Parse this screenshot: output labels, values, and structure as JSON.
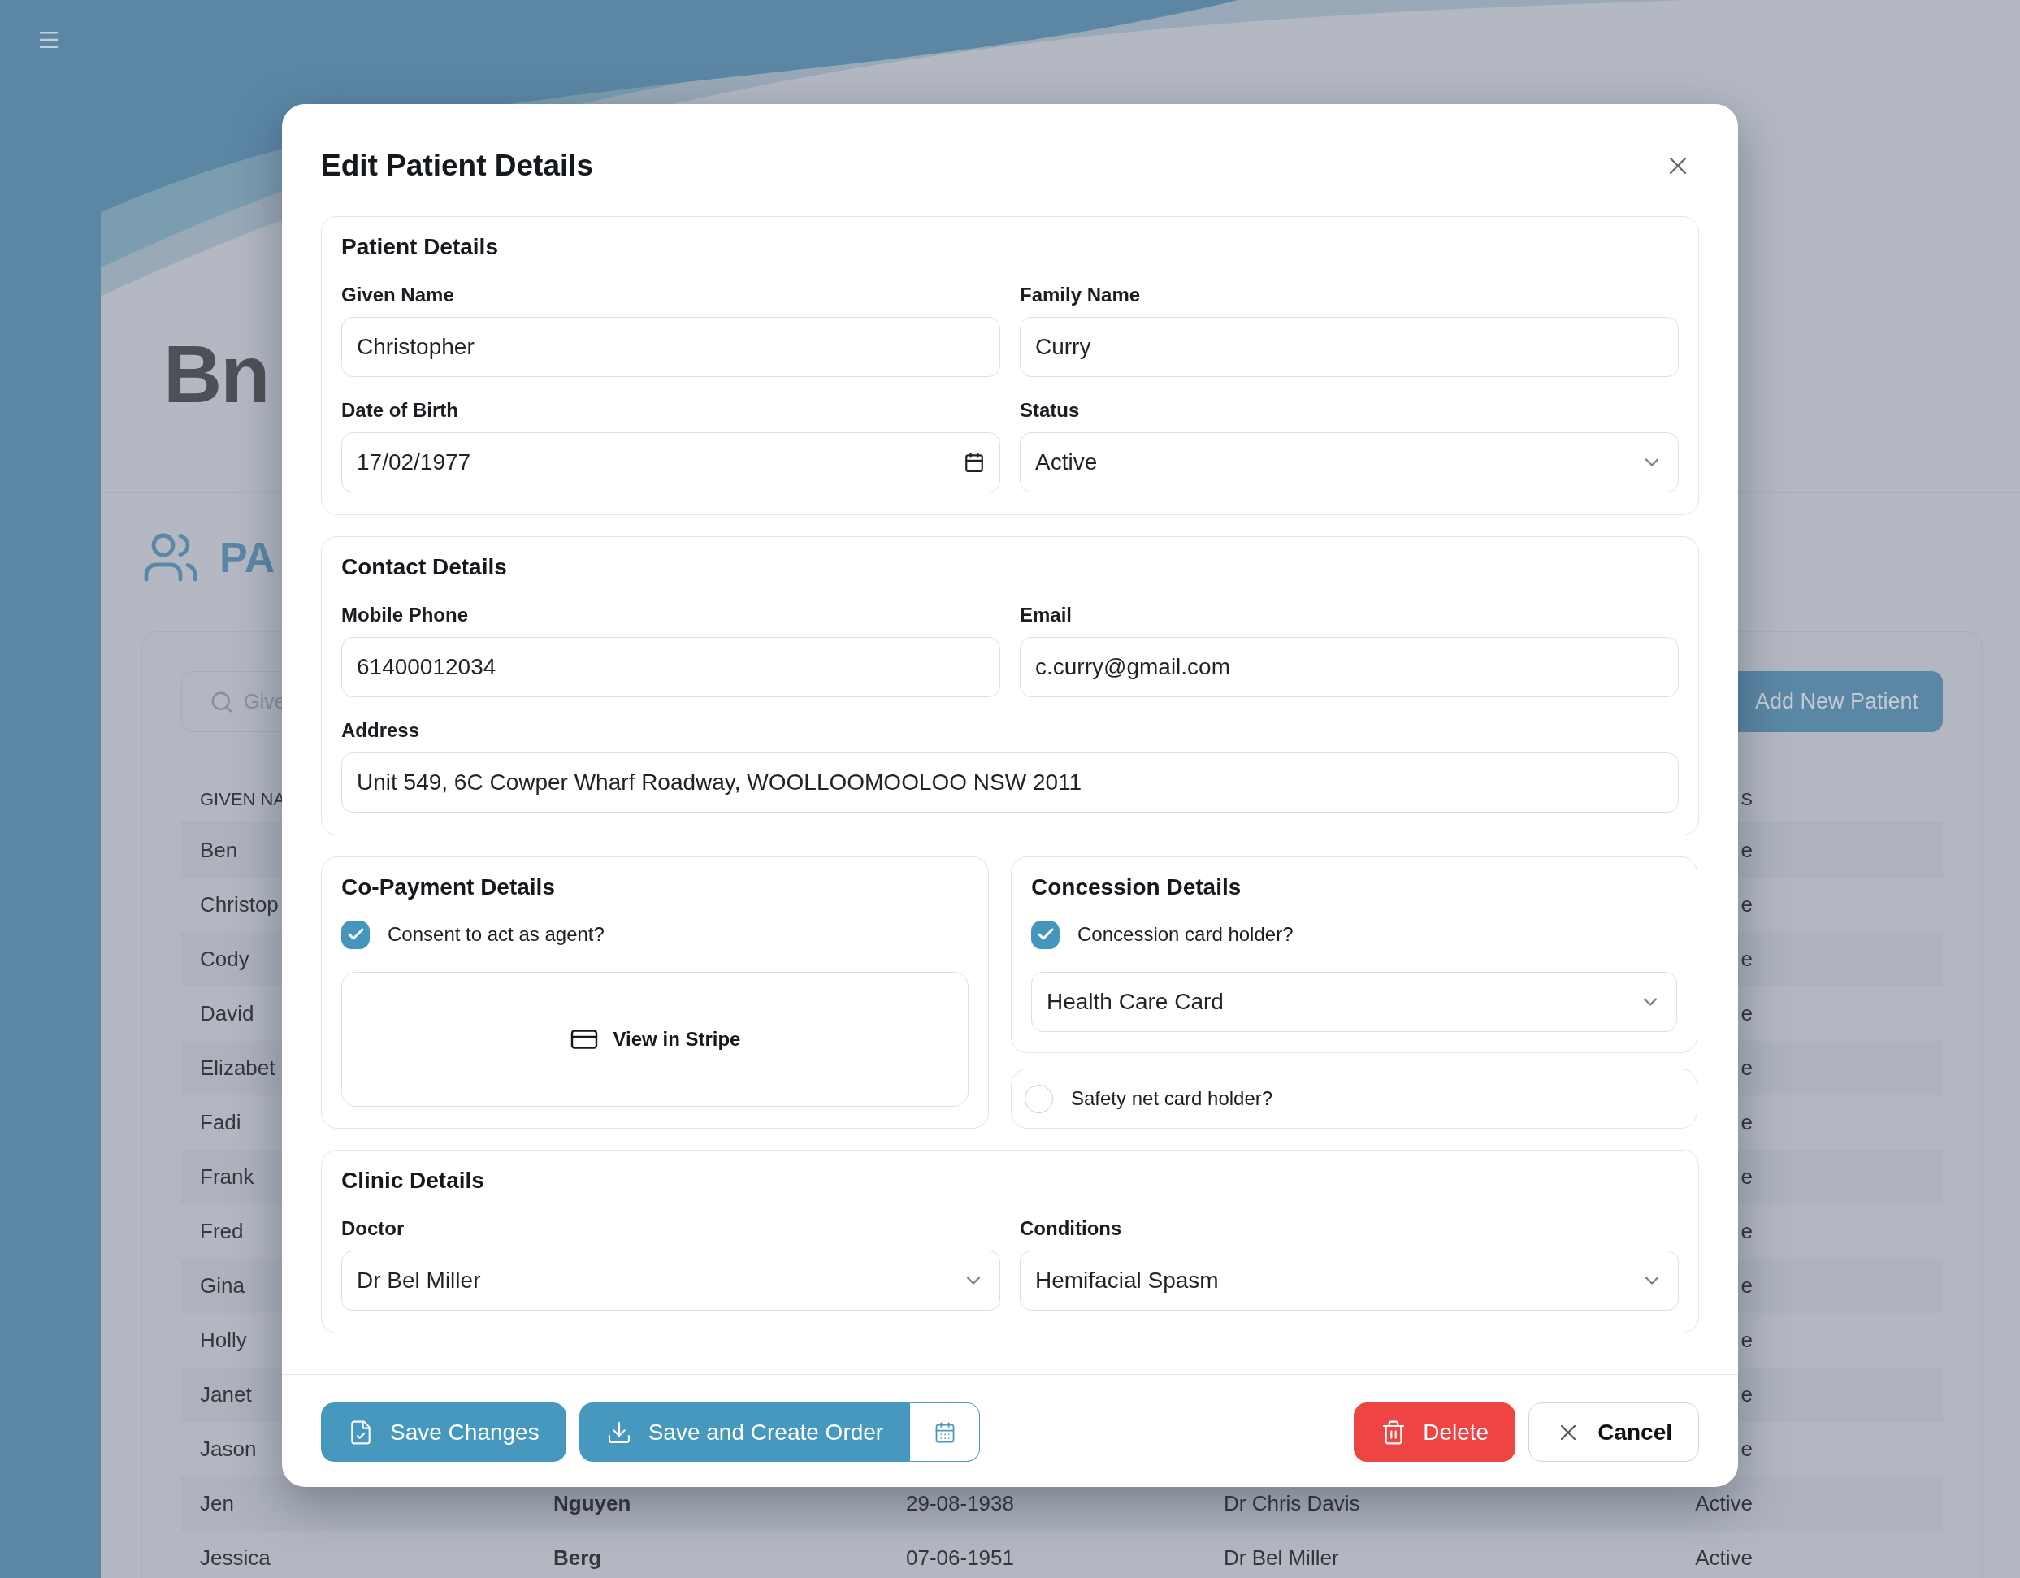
{
  "background": {
    "logo": "Bn",
    "heading": "PA",
    "search": {
      "placeholder": "Give"
    },
    "add_button": "Add New Patient",
    "table": {
      "header_first": "GIVEN NA",
      "header_last": "S",
      "rows": [
        {
          "given_name": "Ben",
          "status": "e"
        },
        {
          "given_name": "Christop",
          "status": "e"
        },
        {
          "given_name": "Cody",
          "status": "e"
        },
        {
          "given_name": "David",
          "status": "e"
        },
        {
          "given_name": "Elizabet",
          "status": "e"
        },
        {
          "given_name": "Fadi",
          "status": "e"
        },
        {
          "given_name": "Frank",
          "status": "e"
        },
        {
          "given_name": "Fred",
          "status": "e"
        },
        {
          "given_name": "Gina",
          "status": "e"
        },
        {
          "given_name": "Holly",
          "status": "e"
        },
        {
          "given_name": "Janet",
          "status": "e"
        },
        {
          "given_name": "Jason",
          "status": "e"
        },
        {
          "given_name": "Jen",
          "family_name": "Nguyen",
          "date_of_birth": "29-08-1938",
          "doctor": "Dr Chris Davis",
          "status": "Active"
        },
        {
          "given_name": "Jessica",
          "family_name": "Berg",
          "date_of_birth": "07-06-1951",
          "doctor": "Dr Bel Miller",
          "status": "Active"
        }
      ]
    }
  },
  "modal": {
    "title": "Edit Patient Details",
    "sections": [
      {
        "heading": "Patient Details",
        "fields": [
          {
            "label": "Given Name",
            "kind": "text",
            "value": "Christopher",
            "wide": false
          },
          {
            "label": "Family Name",
            "kind": "text",
            "value": "Curry",
            "wide": false
          },
          {
            "label": "Date of Birth",
            "kind": "date",
            "value": "17/02/1977",
            "wide": false
          },
          {
            "label": "Status",
            "kind": "select",
            "value": "Active",
            "wide": false
          }
        ]
      },
      {
        "heading": "Contact Details",
        "fields": [
          {
            "label": "Mobile Phone",
            "kind": "text",
            "value": "61400012034",
            "wide": false
          },
          {
            "label": "Email",
            "kind": "text",
            "value": "c.curry@gmail.com",
            "wide": false
          },
          {
            "label": "Address",
            "kind": "text",
            "value": "Unit 549, 6C Cowper Wharf Roadway, WOOLLOOMOOLOO NSW 2011",
            "wide": true
          }
        ]
      }
    ],
    "co_payment": {
      "heading": "Co-Payment Details",
      "consent": {
        "label": "Consent to act as agent?",
        "checked": true
      },
      "stripe_button": "View in Stripe"
    },
    "concession": {
      "heading": "Concession Details",
      "holder": {
        "label": "Concession card holder?",
        "checked": true
      },
      "card_type": {
        "kind": "select",
        "value": "Health Care Card"
      },
      "safety_net": {
        "label": "Safety net card holder?",
        "checked": false
      }
    },
    "clinic": {
      "heading": "Clinic Details",
      "fields": [
        {
          "label": "Doctor",
          "kind": "select",
          "value": "Dr Bel Miller",
          "wide": false
        },
        {
          "label": "Conditions",
          "kind": "select",
          "value": "Hemifacial Spasm",
          "wide": false
        }
      ]
    },
    "buttons": [
      {
        "kind": "primary",
        "label": "Save Changes"
      },
      {
        "kind": "split",
        "label": "Save and Create Order"
      },
      {
        "kind": "danger",
        "label": "Delete"
      },
      {
        "kind": "outline",
        "label": "Cancel"
      }
    ]
  }
}
